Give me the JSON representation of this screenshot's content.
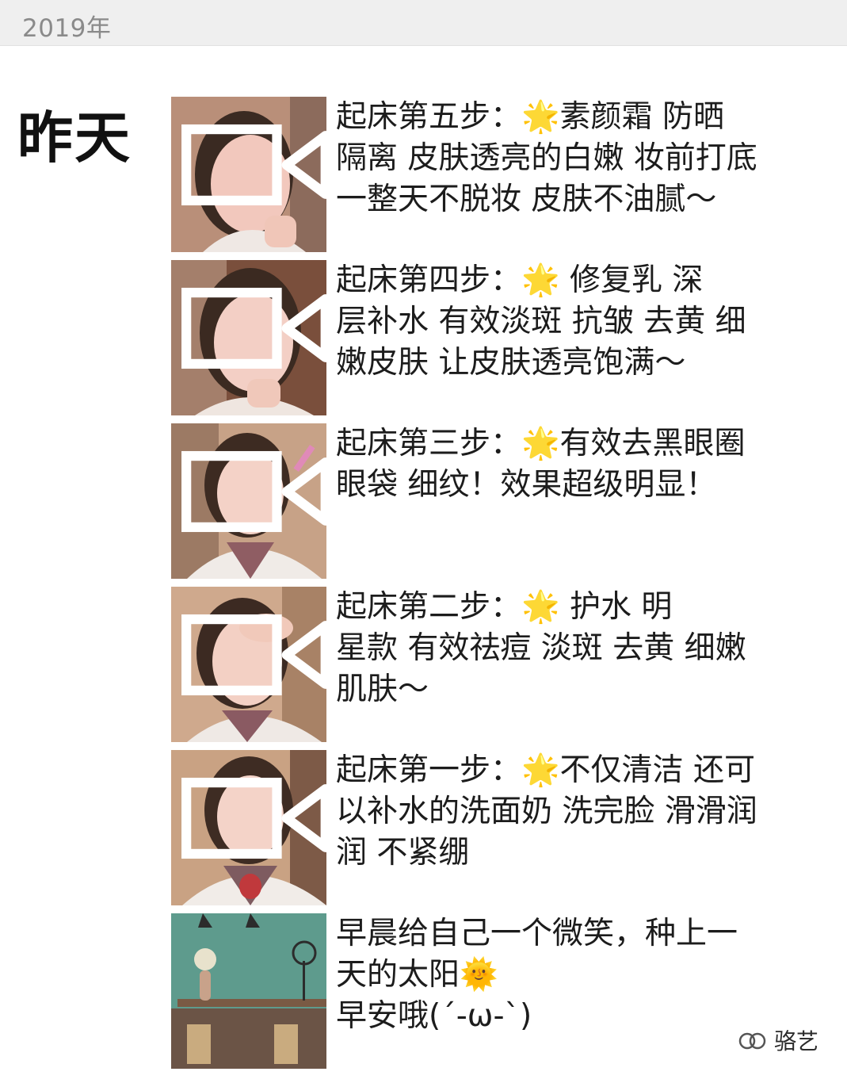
{
  "header": {
    "year": "2019年"
  },
  "day_label": "昨天",
  "posts": [
    {
      "type": "video",
      "text": "起床第五步：🌟素颜霜 防晒\n隔离 皮肤透亮的白嫩 妆前打底\n 一整天不脱妆 皮肤不油腻～"
    },
    {
      "type": "video",
      "text": "起床第四步：🌟       修复乳 深\n层补水 有效淡斑 抗皱 去黄  细\n嫩皮肤 让皮肤透亮饱满～"
    },
    {
      "type": "video",
      "text": "起床第三步：🌟有效去黑眼圈\n眼袋 细纹！效果超级明显！"
    },
    {
      "type": "video",
      "text": "起床第二步：🌟       护水 明\n星款 有效祛痘 淡斑 去黄 细嫩\n肌肤～"
    },
    {
      "type": "video",
      "text": "起床第一步：🌟不仅清洁 还可\n以补水的洗面奶 洗完脸 滑滑润\n润 不紧绷"
    },
    {
      "type": "image",
      "text": "早晨给自己一个微笑，种上一\n天的太阳🌞\n早安哦(´-ω-`)"
    }
  ],
  "watermark": {
    "text": "骆艺",
    "icon": "wechat-channel-icon"
  },
  "colors": {
    "year_bar": "#efefef",
    "year_text": "#8a8a8a",
    "body_text": "#1c1c1c"
  }
}
